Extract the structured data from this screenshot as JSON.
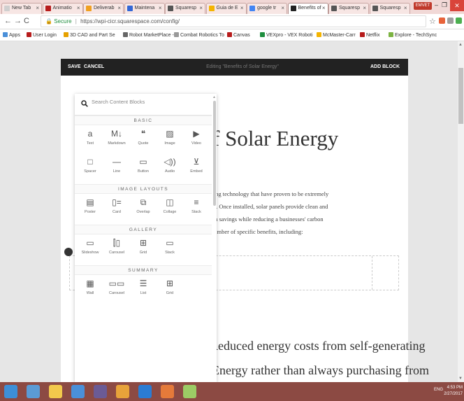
{
  "browser": {
    "tabs": [
      {
        "title": "New Tab",
        "color": "#cfcfcf",
        "active": false
      },
      {
        "title": "Animatio",
        "color": "#b71c1c",
        "active": false
      },
      {
        "title": "Deliverab",
        "color": "#f0a020",
        "active": false
      },
      {
        "title": "Maintena",
        "color": "#3367d6",
        "active": false
      },
      {
        "title": "Squaresp",
        "color": "#555555",
        "active": false
      },
      {
        "title": "Guia de E",
        "color": "#f4b400",
        "active": false
      },
      {
        "title": "google tr",
        "color": "#4285f4",
        "active": false
      },
      {
        "title": "Benefits of",
        "color": "#222222",
        "active": true
      },
      {
        "title": "Squaresp",
        "color": "#555555",
        "active": false
      },
      {
        "title": "Squaresp",
        "color": "#555555",
        "active": false
      }
    ],
    "user_label": "EMVET",
    "address": {
      "secure_label": "Secure",
      "url": "https://wpi-cicr.squarespace.com/config/"
    },
    "bookmarks": [
      {
        "label": "Apps",
        "color": "#4a90d9"
      },
      {
        "label": "User Login",
        "color": "#b71c1c"
      },
      {
        "label": "3D CAD and Part Se",
        "color": "#e6a100"
      },
      {
        "label": "Robot MarketPlace -",
        "color": "#666666"
      },
      {
        "label": "Combat Robotics To",
        "color": "#999999"
      },
      {
        "label": "Canvas",
        "color": "#b71c1c"
      },
      {
        "label": "VEXpro - VEX Roboti",
        "color": "#1e8e3e"
      },
      {
        "label": "McMaster-Carr",
        "color": "#f4b400"
      },
      {
        "label": "Netflix",
        "color": "#b71c1c"
      },
      {
        "label": "Explore - TechSync",
        "color": "#7cb342"
      }
    ]
  },
  "editor": {
    "save_label": "SAVE",
    "cancel_label": "CANCEL",
    "editing_label": "Editing \"Benefits of Solar Energy\"",
    "add_block_label": "ADD BLOCK"
  },
  "content": {
    "headline": "f Solar Energy",
    "body_lines": [
      "cing technology that have proven to be extremely",
      "es. Once installed, solar panels provide clean and",
      "rm savings while reducing a businesses' carbon",
      "number of specific benefits, including:"
    ],
    "heading2": "Reduced energy costs from self-generating",
    "heading3": "Energy rather than always purchasing from"
  },
  "picker": {
    "search_placeholder": "Search Content Blocks",
    "sections": [
      {
        "title": "BASIC",
        "items": [
          {
            "label": "Text",
            "icon": "a"
          },
          {
            "label": "Markdown",
            "icon": "M↓"
          },
          {
            "label": "Quote",
            "icon": "❝"
          },
          {
            "label": "Image",
            "icon": "▨"
          },
          {
            "label": "Video",
            "icon": "▶"
          },
          {
            "label": "Spacer",
            "icon": "□"
          },
          {
            "label": "Line",
            "icon": "—"
          },
          {
            "label": "Button",
            "icon": "▭"
          },
          {
            "label": "Audio",
            "icon": "◁))"
          },
          {
            "label": "Embed",
            "icon": "⊻"
          }
        ]
      },
      {
        "title": "IMAGE LAYOUTS",
        "items": [
          {
            "label": "Poster",
            "icon": "▤"
          },
          {
            "label": "Card",
            "icon": "▯="
          },
          {
            "label": "Overlap",
            "icon": "⧉"
          },
          {
            "label": "Collage",
            "icon": "◫"
          },
          {
            "label": "Stack",
            "icon": "≡"
          }
        ]
      },
      {
        "title": "GALLERY",
        "items": [
          {
            "label": "Slideshow",
            "icon": "▭"
          },
          {
            "label": "Carousel",
            "icon": "⫿▯"
          },
          {
            "label": "Grid",
            "icon": "⊞"
          },
          {
            "label": "Stack",
            "icon": "▭"
          }
        ]
      },
      {
        "title": "SUMMARY",
        "items": [
          {
            "label": "Wall",
            "icon": "▦"
          },
          {
            "label": "Carousel",
            "icon": "▭▭"
          },
          {
            "label": "List",
            "icon": "☰"
          },
          {
            "label": "Grid",
            "icon": "⊞"
          }
        ]
      }
    ]
  },
  "taskbar": {
    "tray_label": "ENG",
    "time": "4:53 PM",
    "date": "2/27/2017"
  }
}
